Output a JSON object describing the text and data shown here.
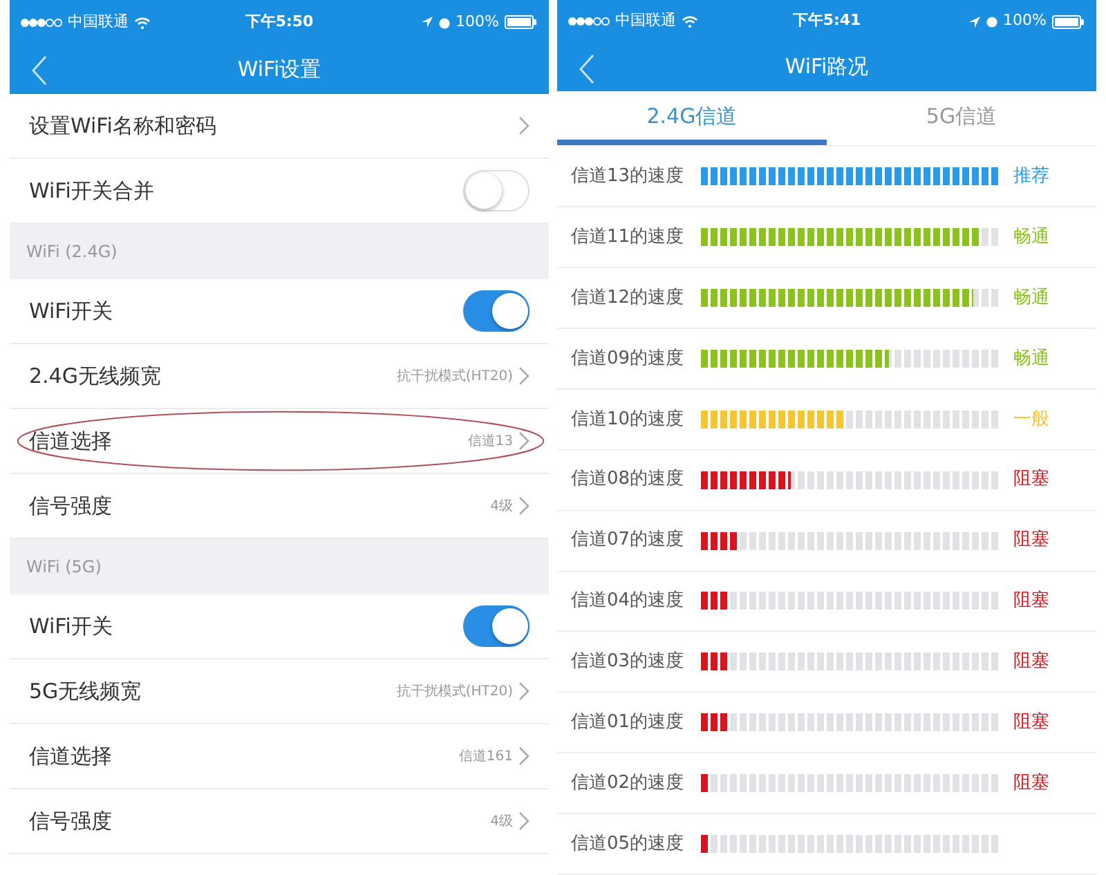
{
  "screens": [
    {
      "status_bar": {
        "carrier": "中国联通",
        "time": "下午5:50",
        "battery": "100%"
      },
      "title": "WiFi设置",
      "sections": [
        {
          "items": [
            {
              "kind": "link",
              "label": "设置WiFi名称和密码",
              "circled": false
            },
            {
              "kind": "toggle",
              "label": "WiFi开关合并",
              "on": false,
              "circled": false
            }
          ]
        },
        {
          "header": "WiFi (2.4G)",
          "items": [
            {
              "kind": "toggle",
              "label": "WiFi开关",
              "on": true,
              "circled": false
            },
            {
              "kind": "link",
              "label": "2.4G无线频宽",
              "value": "抗干扰模式(HT20)",
              "circled": false
            },
            {
              "kind": "link",
              "label": "信道选择",
              "value": "信道13",
              "circled": true
            },
            {
              "kind": "link",
              "label": "信号强度",
              "value": "4级",
              "circled": false
            }
          ]
        },
        {
          "header": "WiFi (5G)",
          "items": [
            {
              "kind": "toggle",
              "label": "WiFi开关",
              "on": true,
              "circled": false
            },
            {
              "kind": "link",
              "label": "5G无线频宽",
              "value": "抗干扰模式(HT20)",
              "circled": false
            },
            {
              "kind": "link",
              "label": "信道选择",
              "value": "信道161",
              "circled": false
            },
            {
              "kind": "link",
              "label": "信号强度",
              "value": "4级",
              "circled": false
            }
          ]
        }
      ]
    },
    {
      "status_bar": {
        "carrier": "中国联通",
        "time": "下午5:41",
        "battery": "100%"
      },
      "title": "WiFi路况",
      "tabs": [
        {
          "label": "2.4G信道",
          "selected": true
        },
        {
          "label": "5G信道",
          "selected": false
        }
      ],
      "channels": [
        {
          "label": "信道13的速度",
          "level": 1.0,
          "color": "#2a9be6",
          "status": "推荐"
        },
        {
          "label": "信道11的速度",
          "level": 0.94,
          "color": "#8cc21e",
          "status": "畅通"
        },
        {
          "label": "信道12的速度",
          "level": 0.91,
          "color": "#8cc21e",
          "status": "畅通"
        },
        {
          "label": "信道09的速度",
          "level": 0.63,
          "color": "#8cc21e",
          "status": "畅通"
        },
        {
          "label": "信道10的速度",
          "level": 0.48,
          "color": "#f5c532",
          "status": "一般"
        },
        {
          "label": "信道08的速度",
          "level": 0.3,
          "color": "#d9141c",
          "status": "阻塞"
        },
        {
          "label": "信道07的速度",
          "level": 0.12,
          "color": "#d9141c",
          "status": "阻塞"
        },
        {
          "label": "信道04的速度",
          "level": 0.09,
          "color": "#d9141c",
          "status": "阻塞"
        },
        {
          "label": "信道03的速度",
          "level": 0.09,
          "color": "#d9141c",
          "status": "阻塞"
        },
        {
          "label": "信道01的速度",
          "level": 0.09,
          "color": "#d9141c",
          "status": "阻塞"
        },
        {
          "label": "信道02的速度",
          "level": 0.03,
          "color": "#d9141c",
          "status": "阻塞"
        },
        {
          "label": "信道05的速度",
          "level": 0.03,
          "color": "#d9141c"
        }
      ]
    }
  ]
}
